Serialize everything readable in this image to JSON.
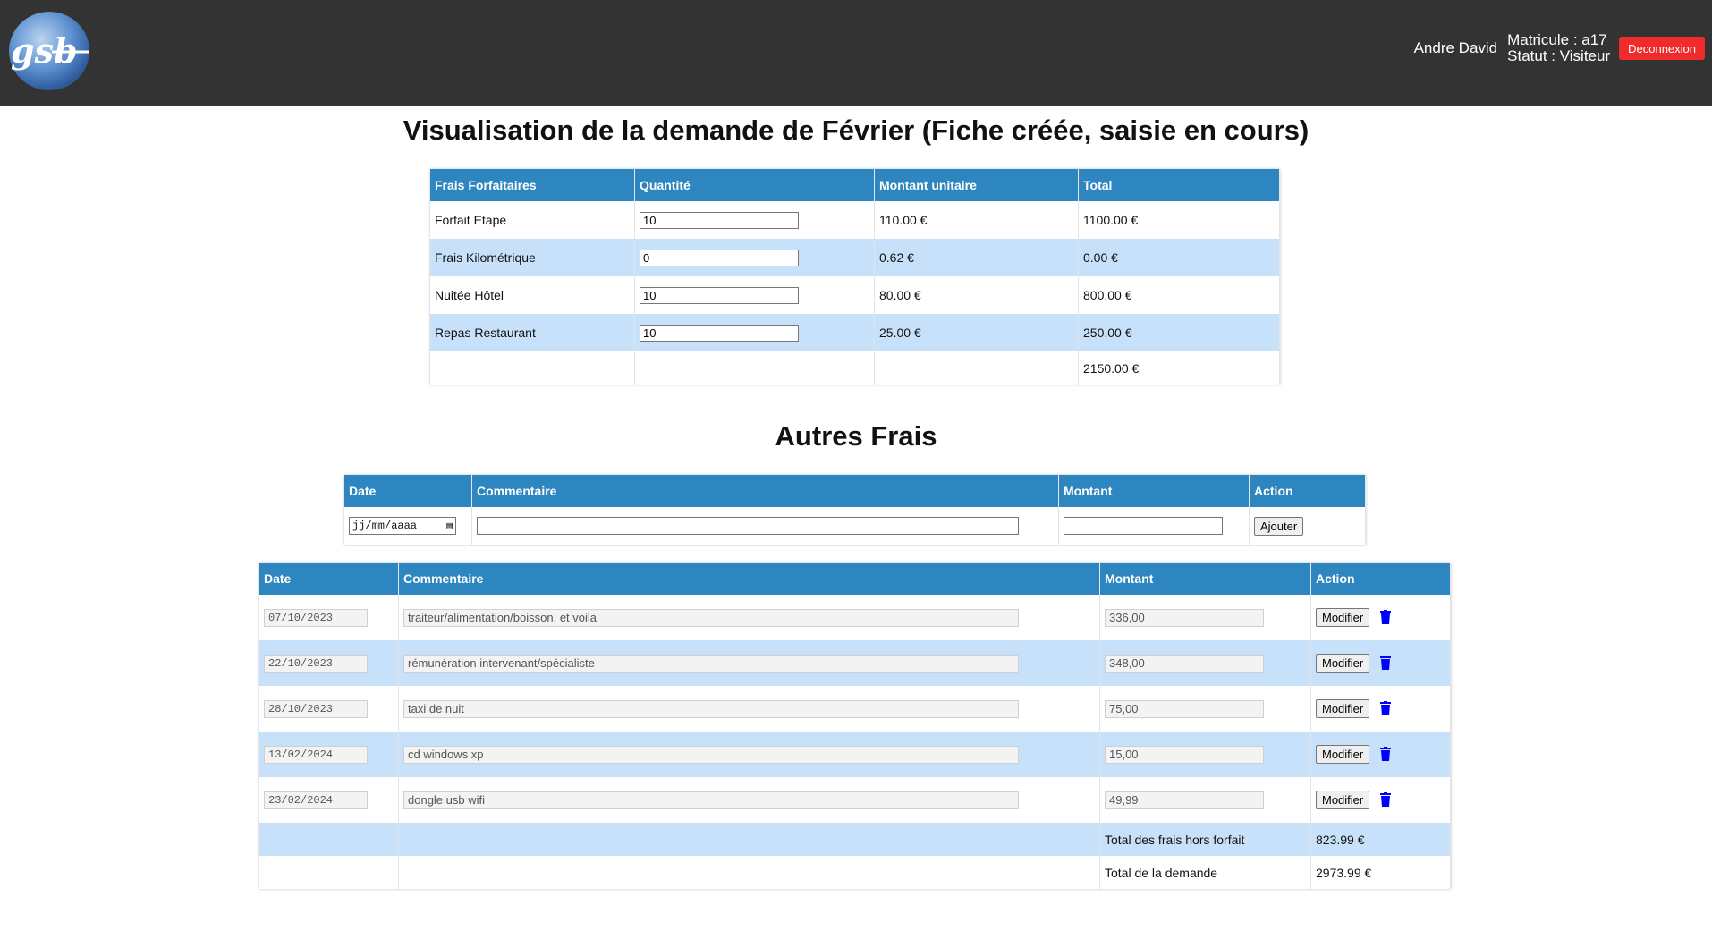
{
  "header": {
    "logo_text": "gsb",
    "user_name": "Andre David",
    "matricule": "Matricule : a17",
    "statut": "Statut : Visiteur",
    "logout_label": "Deconnexion",
    "logout_color": "#f02b2b"
  },
  "title": "Visualisation de la demande de Février (Fiche créée, saisie en cours)",
  "forfait": {
    "headers": [
      "Frais Forfaitaires",
      "Quantité",
      "Montant unitaire",
      "Total"
    ],
    "rows": [
      {
        "label": "Forfait Etape",
        "qty": "10",
        "unit": "110.00 €",
        "total": "1100.00 €"
      },
      {
        "label": "Frais Kilométrique",
        "qty": "0",
        "unit": "0.62 €",
        "total": "0.00 €"
      },
      {
        "label": "Nuitée Hôtel",
        "qty": "10",
        "unit": "80.00 €",
        "total": "800.00 €"
      },
      {
        "label": "Repas Restaurant",
        "qty": "10",
        "unit": "25.00 €",
        "total": "250.00 €"
      }
    ],
    "grand_total": "2150.00 €"
  },
  "autres": {
    "title": "Autres Frais",
    "add_headers": [
      "Date",
      "Commentaire",
      "Montant",
      "Action"
    ],
    "date_placeholder": "jj/mm/aaaa",
    "add_label": "Ajouter",
    "list_headers": [
      "Date",
      "Commentaire",
      "Montant",
      "Action"
    ],
    "rows": [
      {
        "date": "07/10/2023",
        "comment": "traiteur/alimentation/boisson, et voila",
        "amount": "336,00"
      },
      {
        "date": "22/10/2023",
        "comment": "rémunération intervenant/spécialiste",
        "amount": "348,00"
      },
      {
        "date": "28/10/2023",
        "comment": "taxi de nuit",
        "amount": "75,00"
      },
      {
        "date": "13/02/2024",
        "comment": "cd windows xp",
        "amount": "15,00"
      },
      {
        "date": "23/02/2024",
        "comment": "dongle usb wifi",
        "amount": "49,99"
      }
    ],
    "modify_label": "Modifier",
    "total_hf_label": "Total des frais hors forfait",
    "total_hf": "823.99 €",
    "total_demande_label": "Total de la demande",
    "total_demande": "2973.99 €"
  },
  "colors": {
    "header_bg": "#333333",
    "table_head": "#2e86c1",
    "row_alt": "#c8e1fb",
    "trash": "#0000ff"
  }
}
